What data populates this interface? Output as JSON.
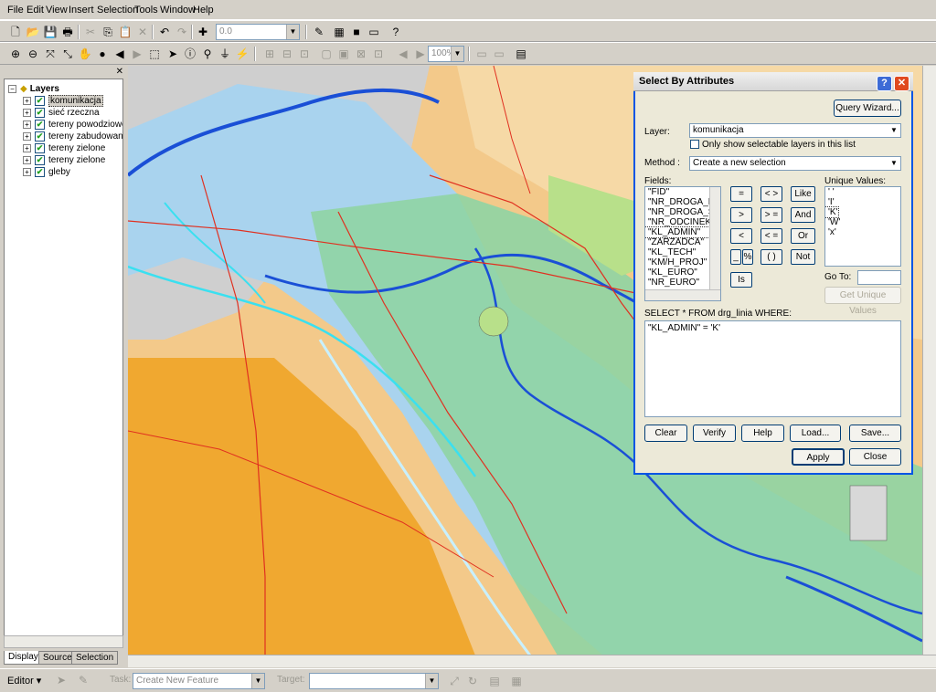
{
  "menu": [
    "File",
    "Edit",
    "View",
    "Insert",
    "Selection",
    "Tools",
    "Window",
    "Help"
  ],
  "toolbar": {
    "scale_value": "0.0",
    "zoom_value": "100%"
  },
  "toc": {
    "root_label": "Layers",
    "layers": [
      {
        "name": "komunikacja",
        "checked": true,
        "highlighted": true
      },
      {
        "name": "sieć rzeczna",
        "checked": true
      },
      {
        "name": "tereny powodziowe",
        "checked": true
      },
      {
        "name": "tereny zabudowane",
        "checked": true
      },
      {
        "name": "tereny zielone",
        "checked": true
      },
      {
        "name": "tereny zielone",
        "checked": true
      },
      {
        "name": "gleby",
        "checked": true
      }
    ],
    "tabs": [
      "Display",
      "Source",
      "Selection"
    ]
  },
  "editor": {
    "editor_label": "Editor ▾",
    "task_label": "Task:",
    "task_value": "Create New Feature",
    "target_label": "Target:",
    "target_value": ""
  },
  "dialog": {
    "title": "Select By Attributes",
    "help_glyph": "?",
    "close_glyph": "✕",
    "query_wizard": "Query Wizard...",
    "layer_label": "Layer:",
    "layer_value": "komunikacja",
    "only_selectable": "Only show selectable layers in this list",
    "method_label": "Method :",
    "method_value": "Create a new selection",
    "fields_label": "Fields:",
    "fields": [
      "\"FID\"",
      "\"NR_DROGA_N\"",
      "\"NR_DROGA_S\"",
      "\"NR_ODCINEK\"",
      "\"KL_ADMIN\"",
      "\"ZARZADCA\"",
      "\"KL_TECH\"",
      "\"KM/H_PROJ\"",
      "\"KL_EURO\"",
      "\"NR_EURO\""
    ],
    "unique_label": "Unique Values:",
    "unique_values": [
      "' '",
      "'I'",
      "'K'",
      "'W'",
      "'x'"
    ],
    "operators": [
      "=",
      "< >",
      "Like",
      ">",
      "> =",
      "And",
      "<",
      "< =",
      "Or",
      "_",
      "%",
      "( )",
      "Not",
      "Is"
    ],
    "goto_label": "Go To:",
    "get_unique": "Get Unique Values",
    "select_from": "SELECT * FROM drg_linia WHERE:",
    "expression": "\"KL_ADMIN\" = 'K'",
    "buttons": [
      "Clear",
      "Verify",
      "Help",
      "Load...",
      "Save..."
    ],
    "apply": "Apply",
    "close": "Close"
  },
  "colors": {
    "river_blue": "#1a4fd6",
    "road_red": "#e03020",
    "flood_light_blue": "#a9d3ee",
    "green": "#8fd4a3",
    "orange": "#f0a830",
    "title_gradient": "#d7d7d7"
  }
}
